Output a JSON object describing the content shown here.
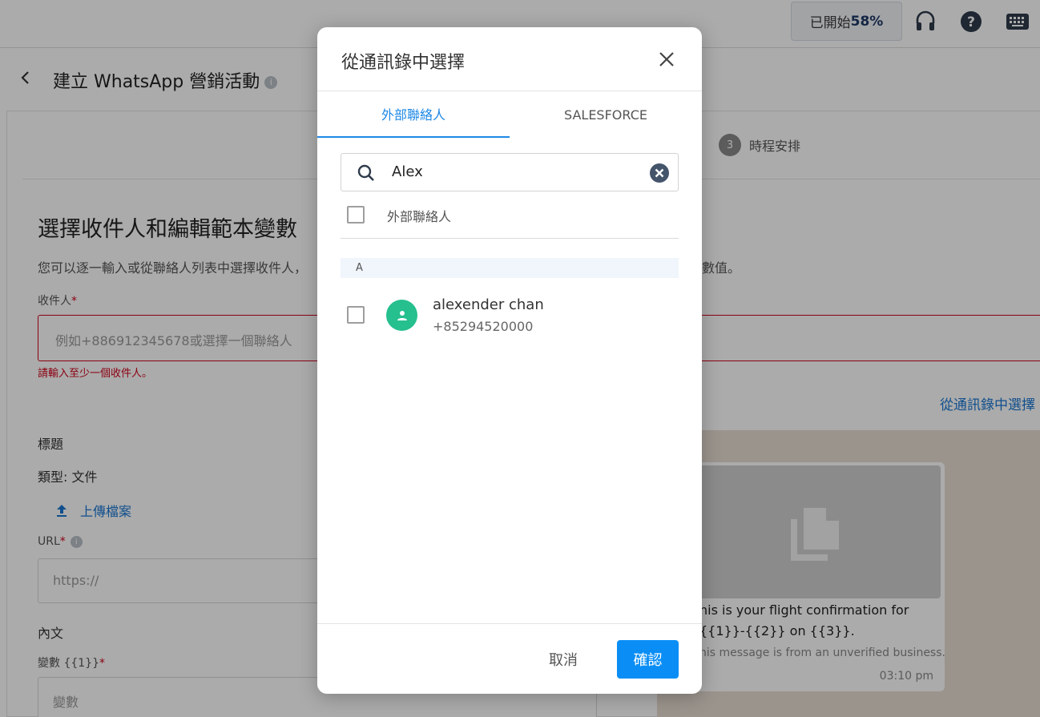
{
  "topbar": {
    "progress_prefix": "已開始",
    "progress_value": "58%",
    "icons": [
      "headset-icon",
      "help-icon",
      "keyboard-icon"
    ]
  },
  "page": {
    "title": "建立 WhatsApp 營銷活動",
    "step3_number": "3",
    "step3_label": "時程安排",
    "section_title": "選擇收件人和編輯範本變數",
    "section_desc": "您可以逐一輸入或從聯絡人列表中選擇收件人，",
    "section_desc_tail": "數值。",
    "recipients_label": "收件人",
    "recipients_placeholder": "例如+886912345678或選擇一個聯絡人",
    "recipients_error": "請輸入至少一個收件人。",
    "choose_from_contacts_link": "從通訊錄中選擇",
    "header_label": "標題",
    "type_label": "類型: 文件",
    "upload_label": "上傳檔案",
    "url_label": "URL",
    "url_placeholder": "https://",
    "body_label": "內文",
    "variable_label": "變數 {{1}}",
    "variable_placeholder": "變數"
  },
  "preview": {
    "message": "his is your flight confirmation for {{1}}-{{2}} on {{3}}.",
    "note": "his message is from an unverified business.",
    "time": "03:10 pm"
  },
  "modal": {
    "title": "從通訊錄中選擇",
    "tabs": [
      {
        "label": "外部聯絡人",
        "active": true
      },
      {
        "label": "SALESFORCE",
        "active": false
      }
    ],
    "search_value": "Alex",
    "select_all_label": "外部聯絡人",
    "group_letter": "A",
    "contacts": [
      {
        "name": "alexender chan",
        "phone": "+85294520000"
      }
    ],
    "cancel_label": "取消",
    "confirm_label": "確認"
  },
  "colors": {
    "accent": "#1e88e5",
    "confirm": "#0a8ef5",
    "avatar": "#26bf8e",
    "error": "#d0021b"
  }
}
